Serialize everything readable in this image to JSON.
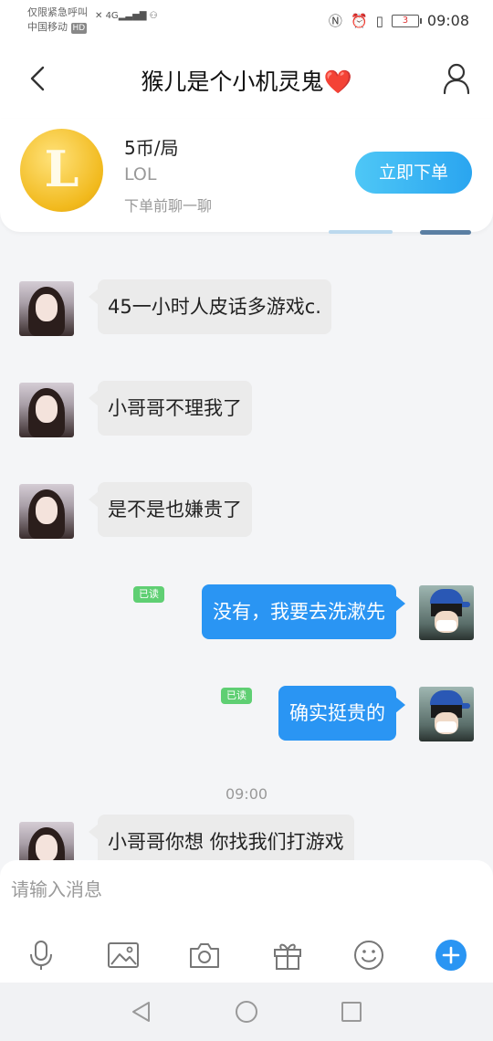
{
  "status_bar": {
    "emergency_text": "仅限紧急呼叫",
    "carrier": "中国移动",
    "hd": "HD",
    "network": "4G",
    "battery": "3",
    "time": "09:08"
  },
  "header": {
    "title": "猴儿是个小机灵鬼",
    "title_emoji": "❤️"
  },
  "order_card": {
    "logo_letter": "L",
    "price": "5币/局",
    "game": "LOL",
    "tip": "下单前聊一聊",
    "button_label": "立即下单"
  },
  "messages": [
    {
      "side": "in",
      "text": "45一小时人皮话多游戏c."
    },
    {
      "side": "in",
      "text": "小哥哥不理我了"
    },
    {
      "side": "in",
      "text": "是不是也嫌贵了"
    },
    {
      "side": "out",
      "text": "没有，我要去洗漱先",
      "status": "已读"
    },
    {
      "side": "out",
      "text": "确实挺贵的",
      "status": "已读"
    },
    {
      "side": "in",
      "text": "小哥哥你想  你找我们打游戏"
    }
  ],
  "timestamp": "09:00",
  "composer": {
    "placeholder": "请输入消息"
  },
  "colors": {
    "accent": "#2a95f3",
    "button_gradient_start": "#4ec7f6",
    "read_badge": "#5fcf73",
    "heart": "#e0201f"
  }
}
